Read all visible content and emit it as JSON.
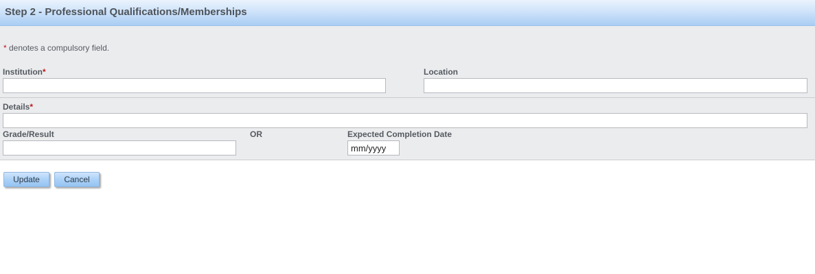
{
  "header": {
    "title": "Step 2 - Professional Qualifications/Memberships"
  },
  "form": {
    "required_note": {
      "star": "*",
      "text": " denotes a compulsory field."
    },
    "institution": {
      "label": "Institution",
      "star": "*",
      "value": ""
    },
    "location": {
      "label": "Location",
      "value": ""
    },
    "details": {
      "label": "Details",
      "star": "*",
      "value": ""
    },
    "grade": {
      "label": "Grade/Result",
      "value": ""
    },
    "or_label": "OR",
    "completion": {
      "label": "Expected Completion Date",
      "placeholder": "mm/yyyy",
      "value": ""
    }
  },
  "buttons": {
    "update_label": "Update",
    "cancel_label": "Cancel"
  },
  "colors": {
    "required": "#c0151b",
    "button": "#a9d0f7",
    "header": "#cfe3fa"
  }
}
